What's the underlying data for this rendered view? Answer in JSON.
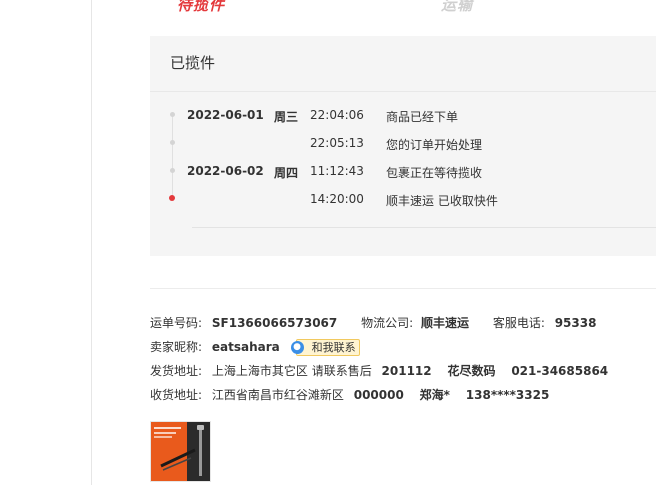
{
  "status_tabs": {
    "pending_pickup": "待揽件",
    "in_transit": "运输"
  },
  "tracking": {
    "current_status": "已揽件",
    "events": [
      {
        "date": "2022-06-01",
        "weekday": "周三",
        "time": "22:04:06",
        "desc": "商品已经下单"
      },
      {
        "date": "",
        "weekday": "",
        "time": "22:05:13",
        "desc": "您的订单开始处理"
      },
      {
        "date": "2022-06-02",
        "weekday": "周四",
        "time": "11:12:43",
        "desc": "包裹正在等待揽收"
      },
      {
        "date": "",
        "weekday": "",
        "time": "14:20:00",
        "desc": "顺丰速运 已收取快件"
      }
    ]
  },
  "shipment": {
    "waybill_label": "运单号码:",
    "waybill_no": "SF1366066573067",
    "carrier_label": "物流公司:",
    "carrier": "顺丰速运",
    "phone_label": "客服电话:",
    "phone": "95338",
    "seller_label": "卖家昵称:",
    "seller": "eatsahara",
    "contact_button": "和我联系",
    "ship_from_label": "发货地址:",
    "ship_from_address": "上海上海市其它区 请联系售后",
    "ship_from_zip": "201112",
    "ship_from_name": "花尽数码",
    "ship_from_phone": "021-34685864",
    "ship_to_label": "收货地址:",
    "ship_to_address": "江西省南昌市红谷滩新区",
    "ship_to_zip": "000000",
    "ship_to_name": "郑海*",
    "ship_to_phone": "138****3325"
  },
  "colors": {
    "accent": "#e4393c",
    "panel_bg": "#f5f5f5"
  },
  "icons": {
    "contact": "chat-bubble-icon",
    "product": "product-thumbnail"
  }
}
